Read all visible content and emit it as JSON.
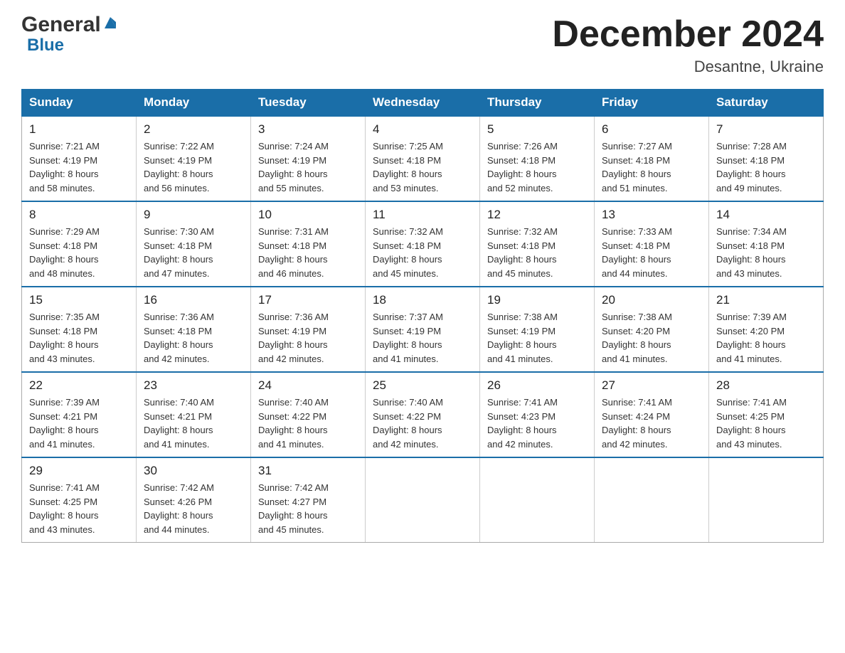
{
  "logo": {
    "general": "General",
    "blue": "Blue"
  },
  "header": {
    "month_year": "December 2024",
    "location": "Desantne, Ukraine"
  },
  "weekdays": [
    "Sunday",
    "Monday",
    "Tuesday",
    "Wednesday",
    "Thursday",
    "Friday",
    "Saturday"
  ],
  "weeks": [
    [
      {
        "day": "1",
        "sunrise": "7:21 AM",
        "sunset": "4:19 PM",
        "daylight": "8 hours and 58 minutes."
      },
      {
        "day": "2",
        "sunrise": "7:22 AM",
        "sunset": "4:19 PM",
        "daylight": "8 hours and 56 minutes."
      },
      {
        "day": "3",
        "sunrise": "7:24 AM",
        "sunset": "4:19 PM",
        "daylight": "8 hours and 55 minutes."
      },
      {
        "day": "4",
        "sunrise": "7:25 AM",
        "sunset": "4:18 PM",
        "daylight": "8 hours and 53 minutes."
      },
      {
        "day": "5",
        "sunrise": "7:26 AM",
        "sunset": "4:18 PM",
        "daylight": "8 hours and 52 minutes."
      },
      {
        "day": "6",
        "sunrise": "7:27 AM",
        "sunset": "4:18 PM",
        "daylight": "8 hours and 51 minutes."
      },
      {
        "day": "7",
        "sunrise": "7:28 AM",
        "sunset": "4:18 PM",
        "daylight": "8 hours and 49 minutes."
      }
    ],
    [
      {
        "day": "8",
        "sunrise": "7:29 AM",
        "sunset": "4:18 PM",
        "daylight": "8 hours and 48 minutes."
      },
      {
        "day": "9",
        "sunrise": "7:30 AM",
        "sunset": "4:18 PM",
        "daylight": "8 hours and 47 minutes."
      },
      {
        "day": "10",
        "sunrise": "7:31 AM",
        "sunset": "4:18 PM",
        "daylight": "8 hours and 46 minutes."
      },
      {
        "day": "11",
        "sunrise": "7:32 AM",
        "sunset": "4:18 PM",
        "daylight": "8 hours and 45 minutes."
      },
      {
        "day": "12",
        "sunrise": "7:32 AM",
        "sunset": "4:18 PM",
        "daylight": "8 hours and 45 minutes."
      },
      {
        "day": "13",
        "sunrise": "7:33 AM",
        "sunset": "4:18 PM",
        "daylight": "8 hours and 44 minutes."
      },
      {
        "day": "14",
        "sunrise": "7:34 AM",
        "sunset": "4:18 PM",
        "daylight": "8 hours and 43 minutes."
      }
    ],
    [
      {
        "day": "15",
        "sunrise": "7:35 AM",
        "sunset": "4:18 PM",
        "daylight": "8 hours and 43 minutes."
      },
      {
        "day": "16",
        "sunrise": "7:36 AM",
        "sunset": "4:18 PM",
        "daylight": "8 hours and 42 minutes."
      },
      {
        "day": "17",
        "sunrise": "7:36 AM",
        "sunset": "4:19 PM",
        "daylight": "8 hours and 42 minutes."
      },
      {
        "day": "18",
        "sunrise": "7:37 AM",
        "sunset": "4:19 PM",
        "daylight": "8 hours and 41 minutes."
      },
      {
        "day": "19",
        "sunrise": "7:38 AM",
        "sunset": "4:19 PM",
        "daylight": "8 hours and 41 minutes."
      },
      {
        "day": "20",
        "sunrise": "7:38 AM",
        "sunset": "4:20 PM",
        "daylight": "8 hours and 41 minutes."
      },
      {
        "day": "21",
        "sunrise": "7:39 AM",
        "sunset": "4:20 PM",
        "daylight": "8 hours and 41 minutes."
      }
    ],
    [
      {
        "day": "22",
        "sunrise": "7:39 AM",
        "sunset": "4:21 PM",
        "daylight": "8 hours and 41 minutes."
      },
      {
        "day": "23",
        "sunrise": "7:40 AM",
        "sunset": "4:21 PM",
        "daylight": "8 hours and 41 minutes."
      },
      {
        "day": "24",
        "sunrise": "7:40 AM",
        "sunset": "4:22 PM",
        "daylight": "8 hours and 41 minutes."
      },
      {
        "day": "25",
        "sunrise": "7:40 AM",
        "sunset": "4:22 PM",
        "daylight": "8 hours and 42 minutes."
      },
      {
        "day": "26",
        "sunrise": "7:41 AM",
        "sunset": "4:23 PM",
        "daylight": "8 hours and 42 minutes."
      },
      {
        "day": "27",
        "sunrise": "7:41 AM",
        "sunset": "4:24 PM",
        "daylight": "8 hours and 42 minutes."
      },
      {
        "day": "28",
        "sunrise": "7:41 AM",
        "sunset": "4:25 PM",
        "daylight": "8 hours and 43 minutes."
      }
    ],
    [
      {
        "day": "29",
        "sunrise": "7:41 AM",
        "sunset": "4:25 PM",
        "daylight": "8 hours and 43 minutes."
      },
      {
        "day": "30",
        "sunrise": "7:42 AM",
        "sunset": "4:26 PM",
        "daylight": "8 hours and 44 minutes."
      },
      {
        "day": "31",
        "sunrise": "7:42 AM",
        "sunset": "4:27 PM",
        "daylight": "8 hours and 45 minutes."
      },
      null,
      null,
      null,
      null
    ]
  ],
  "labels": {
    "sunrise": "Sunrise:",
    "sunset": "Sunset:",
    "daylight": "Daylight:"
  }
}
